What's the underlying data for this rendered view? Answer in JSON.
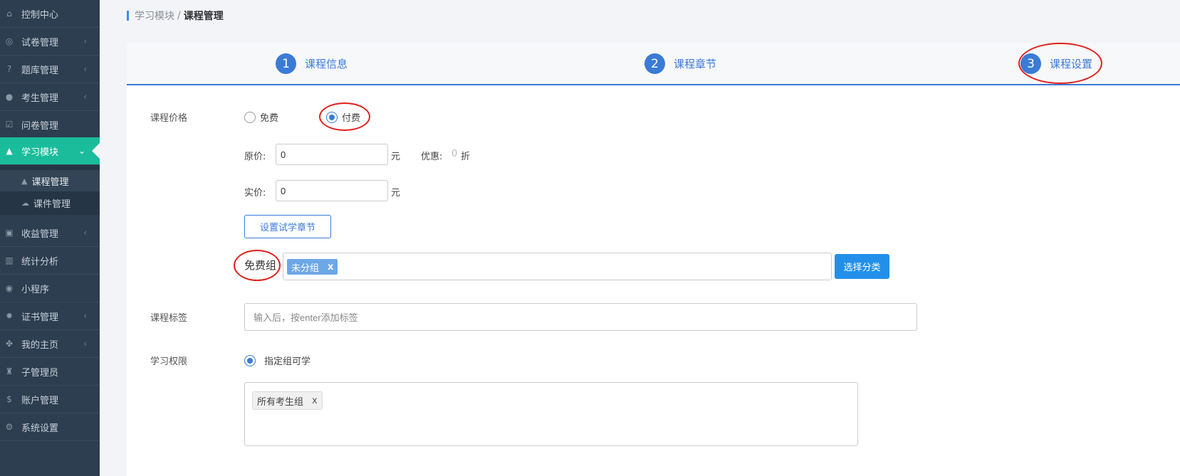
{
  "sidebar": {
    "items": [
      {
        "label": "控制中心",
        "icon": "home-icon",
        "arrow": ""
      },
      {
        "label": "试卷管理",
        "icon": "check-circle-icon",
        "arrow": "‹"
      },
      {
        "label": "题库管理",
        "icon": "question-circle-icon",
        "arrow": "‹"
      },
      {
        "label": "考生管理",
        "icon": "user-icon",
        "arrow": "‹"
      },
      {
        "label": "问卷管理",
        "icon": "check-square-icon",
        "arrow": ""
      },
      {
        "label": "学习模块",
        "icon": "graduation-cap-icon",
        "arrow": "⌄"
      },
      {
        "label": "收益管理",
        "icon": "money-icon",
        "arrow": "‹"
      },
      {
        "label": "统计分析",
        "icon": "bar-chart-icon",
        "arrow": ""
      },
      {
        "label": "小程序",
        "icon": "wechat-icon",
        "arrow": ""
      },
      {
        "label": "证书管理",
        "icon": "certificate-icon",
        "arrow": "‹"
      },
      {
        "label": "我的主页",
        "icon": "leaf-icon",
        "arrow": "‹"
      },
      {
        "label": "子管理员",
        "icon": "user-secret-icon",
        "arrow": ""
      },
      {
        "label": "账户管理",
        "icon": "dollar-icon",
        "arrow": ""
      },
      {
        "label": "系统设置",
        "icon": "gear-icon",
        "arrow": ""
      }
    ],
    "sub_items": [
      {
        "label": "课程管理",
        "icon": "graduation-cap-icon"
      },
      {
        "label": "课件管理",
        "icon": "cloud-upload-icon"
      }
    ]
  },
  "breadcrumb": {
    "parent": "学习模块",
    "separator": "/",
    "current": "课程管理"
  },
  "steps": [
    {
      "num": "1",
      "label": "课程信息"
    },
    {
      "num": "2",
      "label": "课程章节"
    },
    {
      "num": "3",
      "label": "课程设置"
    }
  ],
  "form": {
    "price_label": "课程价格",
    "free_option": "免费",
    "paid_option": "付费",
    "selected_option": "付费",
    "original_price_label": "原价:",
    "original_price_value": "0",
    "unit": "元",
    "discount_label": "优惠:",
    "discount_value": "0",
    "discount_unit": "折",
    "actual_price_label": "实价:",
    "actual_price_value": "0",
    "trial_chapter_button": "设置试学章节",
    "free_group_label": "免费组",
    "free_group_tag": "未分组",
    "tag_remove": "x",
    "select_category_button": "选择分类",
    "course_tag_label": "课程标签",
    "course_tag_placeholder": "输入后，按enter添加标签",
    "permission_label": "学习权限",
    "permission_option": "指定组可学",
    "permission_group_tag": "所有考生组"
  },
  "colors": {
    "sidebar_bg": "#2c3e50",
    "active_item": "#1abc9c",
    "accent": "#3a7bd5",
    "annotation": "#e0201c"
  }
}
